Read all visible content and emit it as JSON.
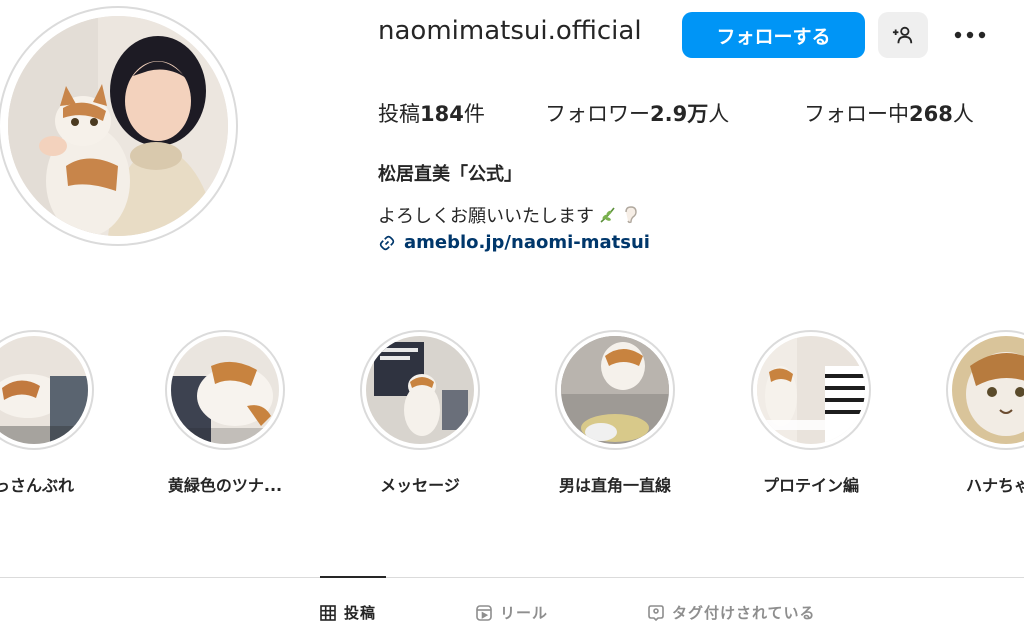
{
  "profile": {
    "username": "naomimatsui.official",
    "follow_label": "フォローする",
    "full_name": "松居直美「公式」",
    "bio": "よろしくお願いいたします",
    "link": "ameblo.jp/naomi-matsui"
  },
  "stats": {
    "posts_prefix": "投稿",
    "posts_count": "184",
    "posts_suffix": "件",
    "followers_prefix": "フォロワー",
    "followers_count": "2.9万",
    "followers_suffix": "人",
    "following_prefix": "フォロー中",
    "following_count": "268",
    "following_suffix": "人"
  },
  "highlights": [
    {
      "label": "っさんぶれ"
    },
    {
      "label": "黄緑色のツナ..."
    },
    {
      "label": "メッセージ"
    },
    {
      "label": "男は直角一直線"
    },
    {
      "label": "プロテイン編"
    },
    {
      "label": "ハナちゃん"
    }
  ],
  "tabs": [
    {
      "label": "投稿",
      "icon": "grid-icon",
      "active": true
    },
    {
      "label": "リール",
      "icon": "reels-icon",
      "active": false
    },
    {
      "label": "タグ付けされている",
      "icon": "tagged-icon",
      "active": false
    }
  ],
  "colors": {
    "primary": "#0095f6",
    "link": "#00376b",
    "text": "#262626",
    "border": "#dbdbdb"
  }
}
